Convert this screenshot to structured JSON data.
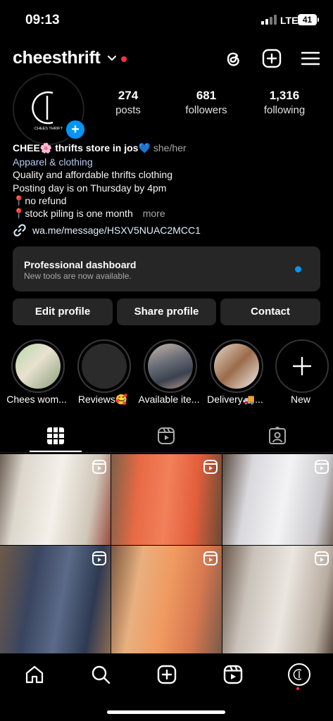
{
  "status": {
    "time": "09:13",
    "network": "LTE",
    "battery": "41"
  },
  "header": {
    "username": "cheesthrift"
  },
  "avatar": {
    "logo_text": "CHEES THRIFT"
  },
  "stats": [
    {
      "value": "274",
      "label": "posts"
    },
    {
      "value": "681",
      "label": "followers"
    },
    {
      "value": "1,316",
      "label": "following"
    }
  ],
  "bio": {
    "name": "CHEE🌸 thrifts store in jos💙",
    "pronouns": "she/her",
    "category": "Apparel & clothing",
    "lines": [
      "Quality and affordable thrifts clothing",
      "Posting day is on Thursday by 4pm",
      "📍no refund",
      "📍stock piling is one month"
    ],
    "more": "more",
    "link": "wa.me/message/HSXV5NUAC2MCC1"
  },
  "dashboard": {
    "title": "Professional dashboard",
    "subtitle": "New tools are now available."
  },
  "buttons": {
    "edit": "Edit profile",
    "share": "Share profile",
    "contact": "Contact"
  },
  "highlights": [
    {
      "label": "Chees wom..."
    },
    {
      "label": "Reviews🥰"
    },
    {
      "label": "Available ite..."
    },
    {
      "label": "Delivery🚚..."
    },
    {
      "label": "New"
    }
  ],
  "colors": {
    "accent": "#0095f6",
    "notification": "#ff3040",
    "card": "#262626"
  },
  "icons": {
    "header": [
      "threads-icon",
      "create-icon",
      "menu-icon"
    ],
    "tabs": [
      "grid-icon",
      "reels-icon",
      "tagged-icon"
    ],
    "nav": [
      "home-icon",
      "search-icon",
      "create-icon",
      "reels-icon",
      "profile-avatar"
    ]
  }
}
